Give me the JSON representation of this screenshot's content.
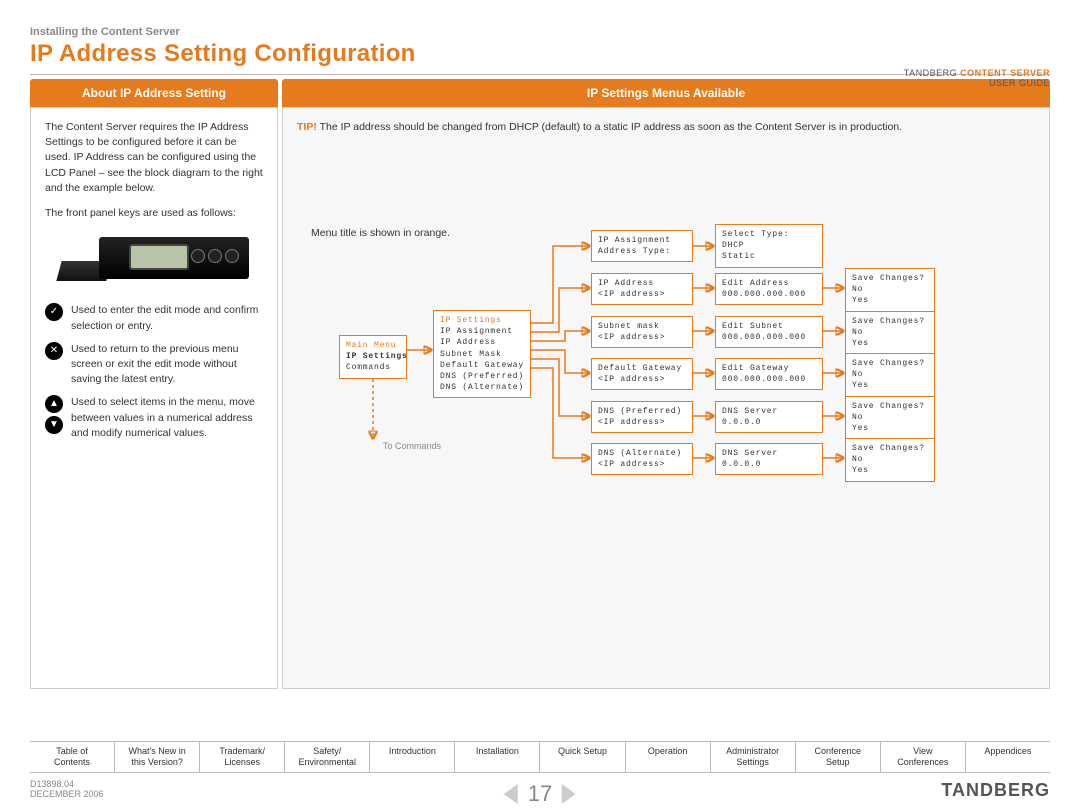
{
  "header": {
    "breadcrumb": "Installing the Content Server",
    "title": "IP Address Setting Configuration",
    "brand_line1a": "TANDBERG ",
    "brand_line1b": "CONTENT SERVER",
    "brand_line2": "USER GUIDE"
  },
  "tabs": {
    "left": "About IP Address Setting",
    "right": "IP Settings Menus Available"
  },
  "about": {
    "p1": "The Content Server requires the IP Address Settings to be configured before it can be used. IP Address can be configured using the LCD Panel – see the block diagram to the right and the example below.",
    "p2": "The front panel keys are used as follows:",
    "key1": "Used to enter the edit mode and confirm selection or entry.",
    "key2": "Used to return to the previous menu screen or exit the edit mode without saving the latest entry.",
    "key3": "Used to select items in the menu, move between values in a numerical address and modify numerical values."
  },
  "tip": {
    "label": "TIP!",
    "text": " The IP address should be changed from DHCP (default) to a static IP address as soon as the Content Server is in production."
  },
  "menunote": "Menu title is shown in orange.",
  "tocommands": "To Commands",
  "diagram": {
    "mainmenu": "Main Menu\nIP Settings\nCommands",
    "ipsettings": "IP Settings\nIP Assignment\nIP Address\nSubnet Mask\nDefault Gateway\nDNS (Preferred)\nDNS (Alternate)",
    "col3": [
      "IP Assignment\nAddress Type:",
      "IP Address\n<IP address>",
      "Subnet mask\n<IP address>",
      "Default Gateway\n<IP address>",
      "DNS (Preferred)\n<IP address>",
      "DNS (Alternate)\n<IP address>"
    ],
    "col4": [
      "Select Type:\nDHCP\nStatic",
      "Edit Address\n000.000.000.000",
      "Edit Subnet\n000.000.000.000",
      "Edit Gateway\n000.000.000.000",
      "DNS Server\n0.0.0.0",
      "DNS Server\n0.0.0.0"
    ],
    "col5": [
      "Save Changes?\nNo\nYes",
      "Save Changes?\nNo\nYes",
      "Save Changes?\nNo\nYes",
      "Save Changes?\nNo\nYes",
      "Save Changes?\nNo\nYes"
    ]
  },
  "nav": [
    "Table of\nContents",
    "What's New in\nthis Version?",
    "Trademark/\nLicenses",
    "Safety/\nEnvironmental",
    "Introduction",
    "Installation",
    "Quick Setup",
    "Operation",
    "Administrator\nSettings",
    "Conference\nSetup",
    "View\nConferences",
    "Appendices"
  ],
  "footer": {
    "docid": "D13898.04",
    "date": "DECEMBER 2006",
    "page": "17",
    "logo": "TANDBERG"
  }
}
